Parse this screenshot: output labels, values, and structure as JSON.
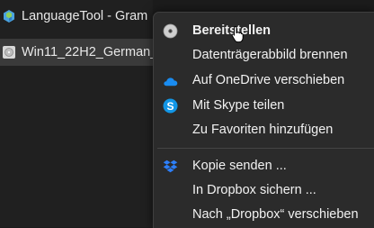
{
  "taskbar": {
    "items": [
      {
        "label": "LanguageTool - Gram",
        "icon": "languagetool-icon"
      },
      {
        "label": "Win11_22H2_German_",
        "icon": "disc-image-icon"
      }
    ]
  },
  "context_menu": {
    "items": [
      {
        "label": "Bereitstellen",
        "icon": "disc-icon",
        "bold": true
      },
      {
        "label": "Datenträgerabbild brennen",
        "icon": ""
      },
      {
        "label": "Auf OneDrive verschieben",
        "icon": "onedrive-icon"
      },
      {
        "label": "Mit Skype teilen",
        "icon": "skype-icon"
      },
      {
        "label": "Zu Favoriten hinzufügen",
        "icon": ""
      },
      {
        "label": "Kopie senden ...",
        "icon": "dropbox-icon"
      },
      {
        "label": "In Dropbox sichern ...",
        "icon": ""
      },
      {
        "label": "Nach „Dropbox“ verschieben",
        "icon": ""
      }
    ]
  },
  "colors": {
    "menu_bg": "#2b2b2b",
    "taskbar_bg": "#202020",
    "selected_task_bg": "#3a3a3a",
    "onedrive_blue": "#1a8cf0",
    "skype_blue": "#1296e6",
    "dropbox_blue": "#2d7ff9"
  }
}
